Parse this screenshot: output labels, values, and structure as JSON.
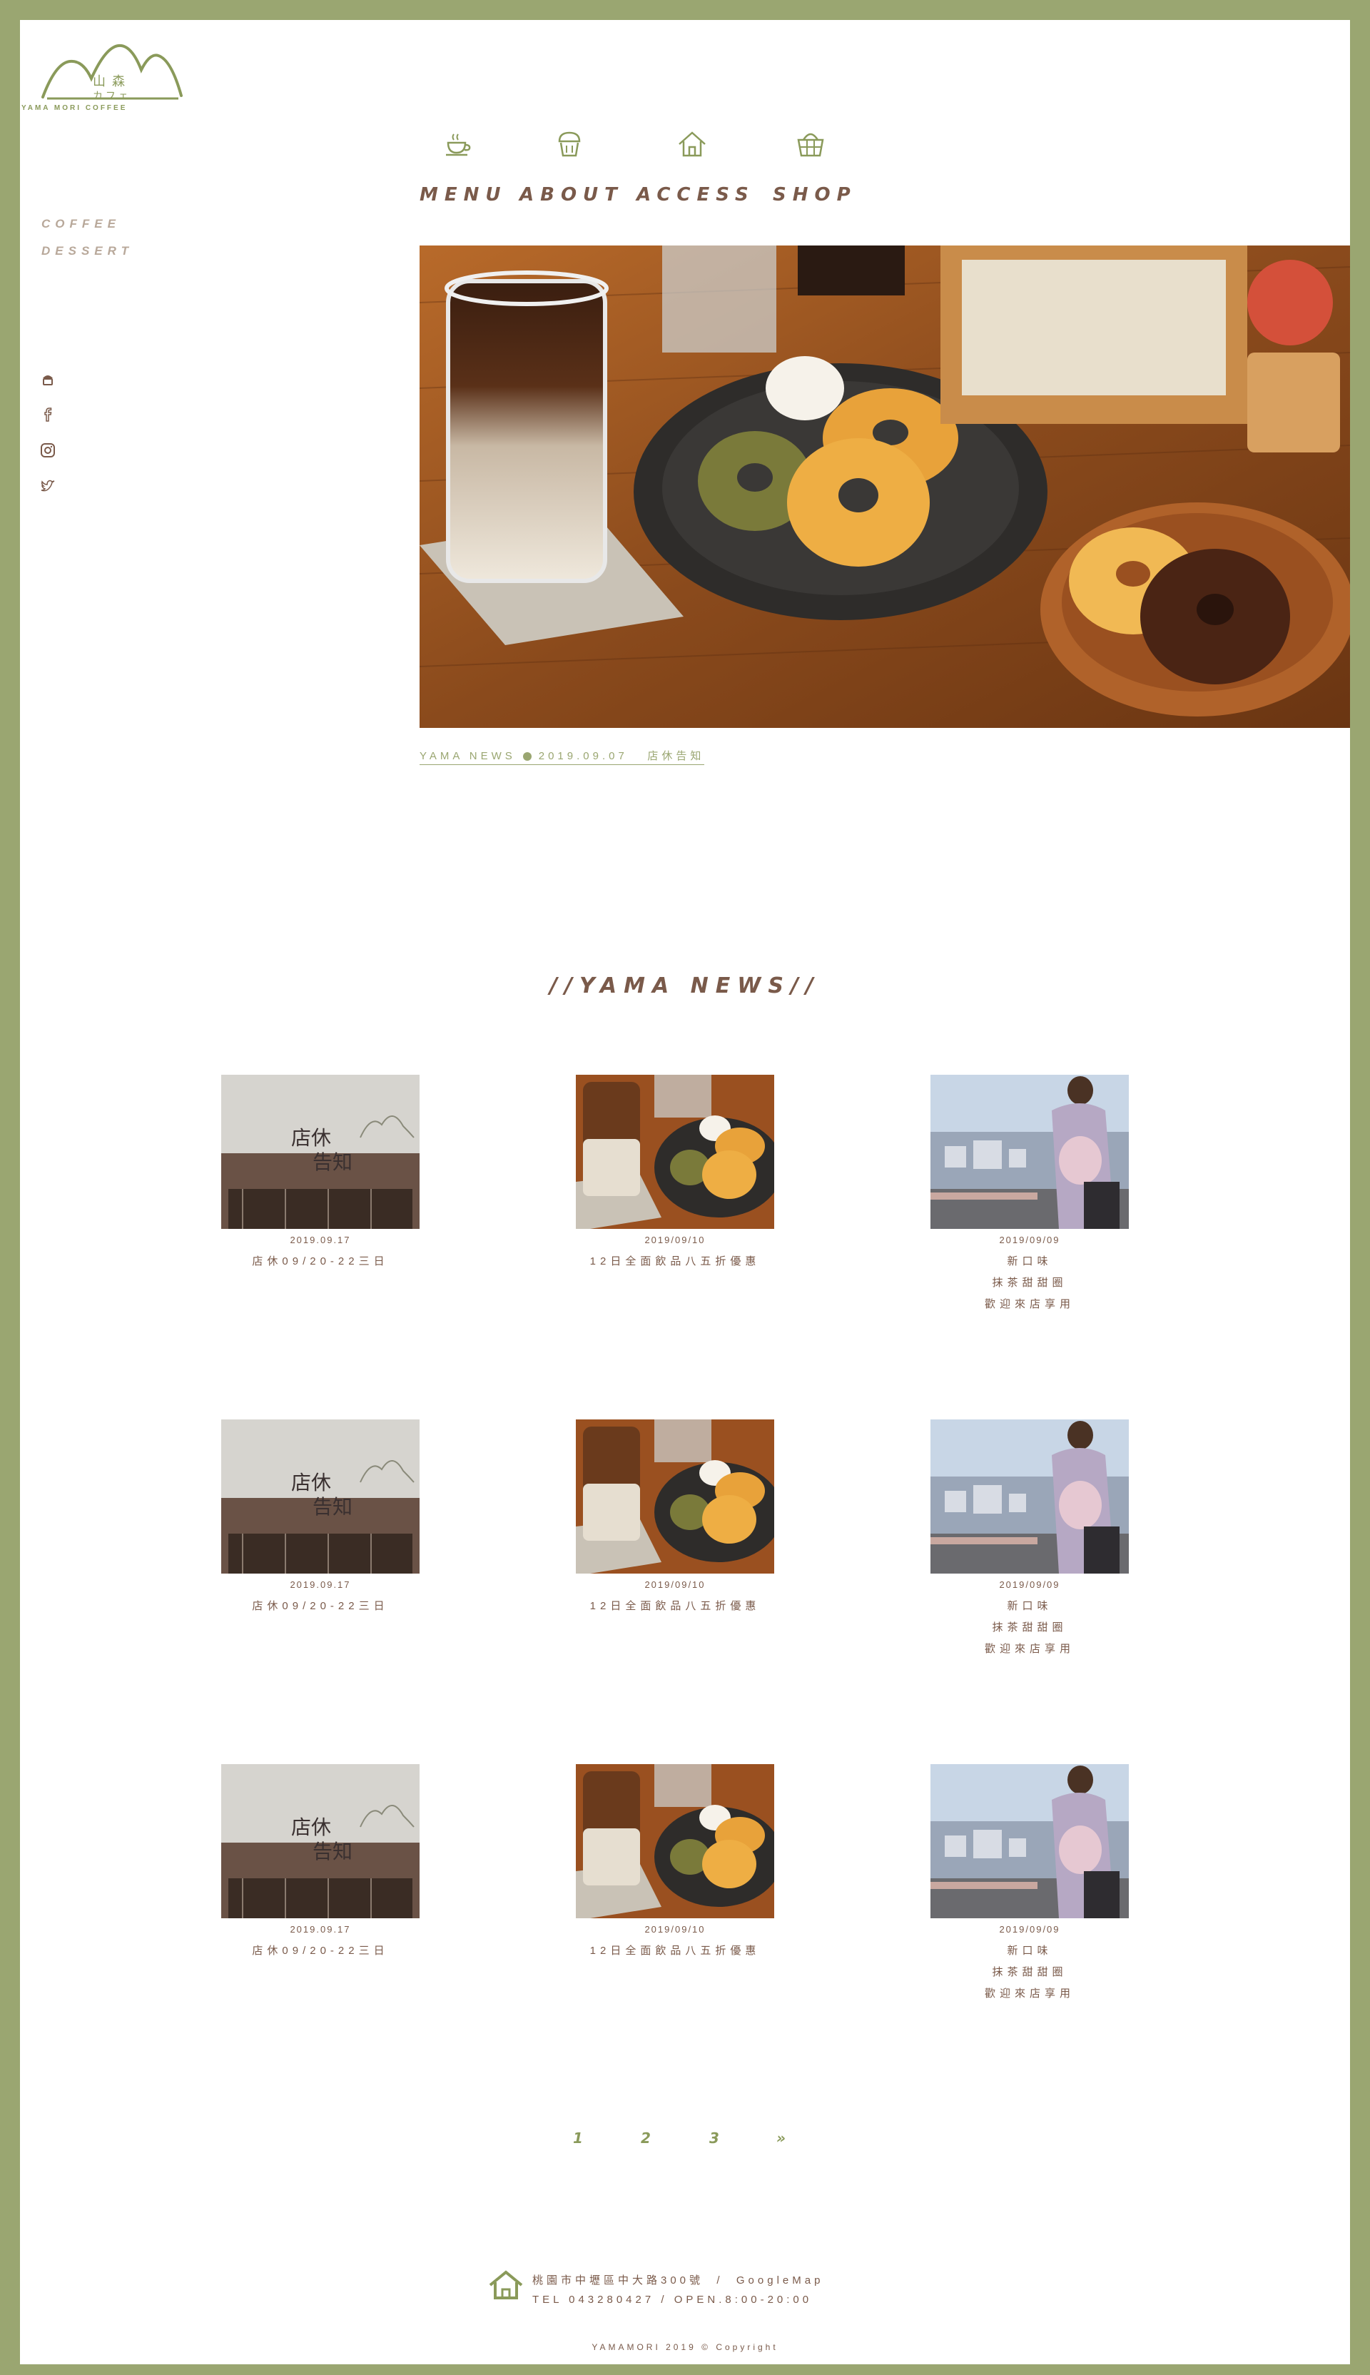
{
  "logo": {
    "kanji_top": "山 森",
    "kana": "カ フ ェ",
    "subtitle": "YAMA MORI COFFEE"
  },
  "side": {
    "tags": [
      "COFFEE",
      "DESSERT"
    ],
    "social_icons": [
      "cupcake-icon",
      "facebook-icon",
      "instagram-icon",
      "twitter-icon"
    ]
  },
  "nav": {
    "items": [
      {
        "label": "MENU",
        "icon": "coffee-cup-icon"
      },
      {
        "label": "ABOUT",
        "icon": "cupcake-icon"
      },
      {
        "label": "ACCESS",
        "icon": "house-icon"
      },
      {
        "label": "SHOP",
        "icon": "basket-icon"
      }
    ]
  },
  "hero": {
    "caption_prefix": "YAMA NEWS",
    "caption_date": "2019.09.07",
    "caption_text": "店休告知"
  },
  "news": {
    "title": "//YAMA NEWS//",
    "rows": [
      [
        {
          "date": "2019.09.17",
          "title": [
            "店休09/20-22三日"
          ],
          "thumb": "closure-notice"
        },
        {
          "date": "2019/09/10",
          "title": [
            "12日全面飲品八五折優惠"
          ],
          "thumb": "coffee-donuts"
        },
        {
          "date": "2019/09/09",
          "title": [
            "新口味",
            "抹茶甜甜圈",
            "歡迎來店享用"
          ],
          "thumb": "woman-bear"
        }
      ],
      [
        {
          "date": "2019.09.17",
          "title": [
            "店休09/20-22三日"
          ],
          "thumb": "closure-notice"
        },
        {
          "date": "2019/09/10",
          "title": [
            "12日全面飲品八五折優惠"
          ],
          "thumb": "coffee-donuts"
        },
        {
          "date": "2019/09/09",
          "title": [
            "新口味",
            "抹茶甜甜圈",
            "歡迎來店享用"
          ],
          "thumb": "woman-bear"
        }
      ],
      [
        {
          "date": "2019.09.17",
          "title": [
            "店休09/20-22三日"
          ],
          "thumb": "closure-notice"
        },
        {
          "date": "2019/09/10",
          "title": [
            "12日全面飲品八五折優惠"
          ],
          "thumb": "coffee-donuts"
        },
        {
          "date": "2019/09/09",
          "title": [
            "新口味",
            "抹茶甜甜圈",
            "歡迎來店享用"
          ],
          "thumb": "woman-bear"
        }
      ]
    ],
    "thumb_text": {
      "line1": "店休",
      "line2": "告知"
    }
  },
  "pagination": {
    "pages": [
      "1",
      "2",
      "3"
    ],
    "next": "»"
  },
  "footer": {
    "address": "桃園市中壢區中大路300號",
    "separator": "/",
    "map_link": "GoogleMap",
    "tel": "TEL 043280427 / OPEN.8:00-20:00",
    "copyright": "YAMAMORI 2019 © Copyright"
  },
  "colors": {
    "frame": "#9aa671",
    "accent_green": "#8a9a5a",
    "text_brown": "#7a5a4a"
  }
}
